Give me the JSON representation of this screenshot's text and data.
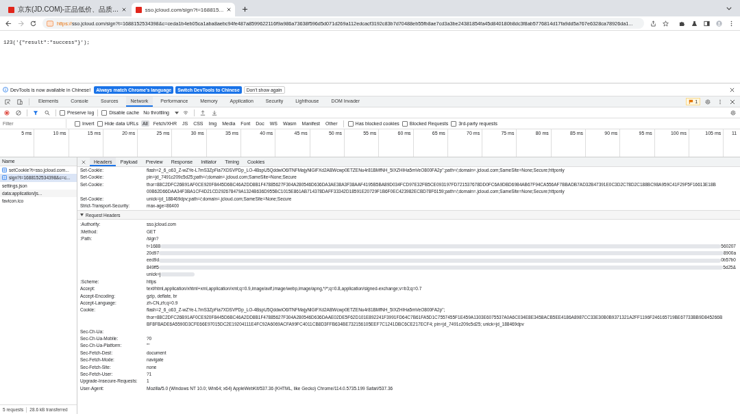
{
  "browser": {
    "tabs": [
      {
        "title": "京东(JD.COM)-正品低价、品质...",
        "selected": false
      },
      {
        "title": "sso.jcloud.com/sign?t=168815...",
        "selected": true
      }
    ],
    "url_scheme": "https://",
    "url_rest": "sso.jcloud.com/sign?t=1688152534398&c=ceda1b4eb05ca1aba8aebc94fe487a8599622116f9a986a73638f596d5d071d269a112edcacf3192c83b7d70488eb55fb8ae7cd3a3be24381854fa45d840180b8dc3f8ab5776814d17fa9dd5a767e6328ca78926da1..."
  },
  "page": {
    "body": "123('{\"result\":\"success\"}');"
  },
  "devtools": {
    "banner": {
      "message": "DevTools is now available in Chinese!",
      "buttons": [
        "Always match Chrome's language",
        "Switch DevTools to Chinese"
      ],
      "dismiss": "Don't show again"
    },
    "tabs": [
      {
        "label": "Elements",
        "selected": false
      },
      {
        "label": "Console",
        "selected": false
      },
      {
        "label": "Sources",
        "selected": false
      },
      {
        "label": "Network",
        "selected": true
      },
      {
        "label": "Performance",
        "selected": false
      },
      {
        "label": "Memory",
        "selected": false
      },
      {
        "label": "Application",
        "selected": false
      },
      {
        "label": "Security",
        "selected": false
      },
      {
        "label": "Lighthouse",
        "selected": false
      },
      {
        "label": "DOM Invader",
        "selected": false
      }
    ],
    "issues_badge": "1",
    "toolbar": {
      "preserve_log": {
        "label": "Preserve log",
        "checked": false
      },
      "disable_cache": {
        "label": "Disable cache",
        "checked": false
      },
      "throttling": "No throttling"
    },
    "filter": {
      "placeholder": "Filter",
      "invert": {
        "label": "Invert",
        "checked": false
      },
      "hide_data_urls": {
        "label": "Hide data URLs",
        "checked": false
      },
      "types": [
        {
          "label": "All",
          "selected": true
        },
        {
          "label": "Fetch/XHR",
          "selected": false
        },
        {
          "label": "JS",
          "selected": false
        },
        {
          "label": "CSS",
          "selected": false
        },
        {
          "label": "Img",
          "selected": false
        },
        {
          "label": "Media",
          "selected": false
        },
        {
          "label": "Font",
          "selected": false
        },
        {
          "label": "Doc",
          "selected": false
        },
        {
          "label": "WS",
          "selected": false
        },
        {
          "label": "Wasm",
          "selected": false
        },
        {
          "label": "Manifest",
          "selected": false
        },
        {
          "label": "Other",
          "selected": false
        }
      ],
      "options": [
        {
          "label": "Has blocked cookies",
          "checked": false
        },
        {
          "label": "Blocked Requests",
          "checked": false
        },
        {
          "label": "3rd-party requests",
          "checked": false
        }
      ]
    },
    "timeline_ticks": [
      "5 ms",
      "10 ms",
      "15 ms",
      "20 ms",
      "25 ms",
      "30 ms",
      "35 ms",
      "40 ms",
      "45 ms",
      "50 ms",
      "55 ms",
      "60 ms",
      "65 ms",
      "70 ms",
      "75 ms",
      "80 ms",
      "85 ms",
      "90 ms",
      "95 ms",
      "100 ms",
      "105 ms",
      "11"
    ],
    "requests": {
      "column": "Name",
      "items": [
        {
          "name": "setCookie?t=sso.jcloud.com...",
          "kind": "document",
          "selected": false
        },
        {
          "name": "sign?t=1688152534398&c=c...",
          "kind": "document",
          "selected": true
        },
        {
          "name": "settings.json",
          "kind": "plain",
          "selected": false
        },
        {
          "name": "data:application/js...",
          "kind": "plain",
          "selected": false
        },
        {
          "name": "favicon.ico",
          "kind": "plain",
          "selected": false
        }
      ],
      "count": "5 requests",
      "transferred": "28.6 kB transferred"
    },
    "detail_tabs": [
      {
        "label": "Headers",
        "selected": true
      },
      {
        "label": "Payload",
        "selected": false
      },
      {
        "label": "Preview",
        "selected": false
      },
      {
        "label": "Response",
        "selected": false
      },
      {
        "label": "Initiator",
        "selected": false
      },
      {
        "label": "Timing",
        "selected": false
      },
      {
        "label": "Cookies",
        "selected": false
      }
    ],
    "response_headers": [
      {
        "name": "Set-Cookie:",
        "lines": [
          "flash=2_6_o63_Z-wZYe-L7mS3ZpFia7XDSVPDp_LO-4BspU5QddwiO6lTNFMajyNlGiFXd2ABWcwp0ETZENu4r81BMfNH_5IXZHIHa5mVeO800FA2p\";path=/;domain=.jcloud.com;SameSite=None;Secure;httponly"
        ]
      },
      {
        "name": "Set-Cookie:",
        "lines": [
          "pin=jd_7491c209c5d25;path=/;domain=.jcloud.com;SameSite=None;Secure"
        ]
      },
      {
        "name": "Set-Cookie:",
        "lines": [
          "thor=88C2DFC26B91AF0CE920F8445D6BC46A2DD8B1F47885627F304A280546D636DA3AE38A3F38AAF4195B5BA89D034FCD97E32FB5CE093197FD721537678DD0FC6A9DBD6984AB67F94CA556AF7BBADB7AD32B47391E0C3D2C78D2C188BC98A959C41F29F5F16613E18B",
          "00B62D66DAA34F3BA1CF4D21CD292678479A1324B636D955BC1015E861AB714378DAFF33342D18591E20729F1B6F0EC423982ECBD78F6159;path=/;domain=.jcloud.com;SameSite=None;Secure;httponly"
        ]
      },
      {
        "name": "Set-Cookie:",
        "lines": [
          "unick=jd_188469dpv;path=/;domain=.jcloud.com;SameSite=None;Secure"
        ]
      },
      {
        "name": "Strict-Transport-Security:",
        "lines": [
          "max-age=86400"
        ]
      }
    ],
    "request_headers_title": "Request Headers",
    "request_headers": [
      {
        "name": ":Authority:",
        "lines": [
          "sso.jcloud.com"
        ]
      },
      {
        "name": ":Method:",
        "lines": [
          "GET"
        ]
      },
      {
        "name": ":Path:",
        "lines": [
          "/sign?"
        ],
        "redacted": [
          {
            "head": "t=1688",
            "tail": "560207"
          },
          {
            "head": "20d97",
            "tail": "8900a"
          },
          {
            "head": "eed9d",
            "tail": "0b57b0"
          },
          {
            "head": "849ff5",
            "tail": "5d25&"
          },
          {
            "head": "unick=j"
          }
        ]
      },
      {
        "name": ":Scheme:",
        "lines": [
          "https"
        ]
      },
      {
        "name": "Accept:",
        "lines": [
          "text/html,application/xhtml+xml,application/xml;q=0.9,image/avif,image/webp,image/apng,*/*;q=0.8,application/signed-exchange;v=b3;q=0.7"
        ]
      },
      {
        "name": "Accept-Encoding:",
        "lines": [
          "gzip, deflate, br"
        ]
      },
      {
        "name": "Accept-Language:",
        "lines": [
          "zh-CN,zh;q=0.9"
        ]
      },
      {
        "name": "Cookie:",
        "lines": [
          "flash=2_6_o63_Z-wZYe-L7mS3ZpFia7XDSVPDp_LO-4BspU5QddwiO6lTNFMajyNlGiFXd2ABWcwp0ETZENu4r81BMfNH_5IXZHIHa5mVeO800FA2p\";",
          "thor=88C2DFC26B91AF0CE920F8445D6BC46A2DD8B1F47885627F304A280546D636DAAE02DE5F62D101E892241F3991FD64C7B61FA5D1C7557455F1E459A1303E6075537A0A6C034E8E3458ACB5EE4186A8987CC33E30B0B9371321A2FF1196F246165719BE67733BB9D845266B",
          "BF8FBADE6A5590D3CFE66E97015DC2E19204111E4FC92A6069ACFA99FC4011CB8D3FFB634BE732156105EEF7C1241DBC6CE217ECF4; pin=jd_7491c209c5d25; unick=jd_188469dpv"
        ]
      },
      {
        "name": "Sec-Ch-Ua:"
      },
      {
        "name": "Sec-Ch-Ua-Mobile:",
        "lines": [
          "?0"
        ]
      },
      {
        "name": "Sec-Ch-Ua-Platform:",
        "lines": [
          "\"\""
        ]
      },
      {
        "name": "Sec-Fetch-Dest:",
        "lines": [
          "document"
        ]
      },
      {
        "name": "Sec-Fetch-Mode:",
        "lines": [
          "navigate"
        ]
      },
      {
        "name": "Sec-Fetch-Site:",
        "lines": [
          "none"
        ]
      },
      {
        "name": "Sec-Fetch-User:",
        "lines": [
          "?1"
        ]
      },
      {
        "name": "Upgrade-Insecure-Requests:",
        "lines": [
          "1"
        ]
      },
      {
        "name": "User-Agent:",
        "lines": [
          "Mozilla/5.0 (Windows NT 10.0; Win64; x64) AppleWebKit/537.36 (KHTML, like Gecko) Chrome/114.0.5735.199 Safari/537.36"
        ]
      }
    ]
  }
}
